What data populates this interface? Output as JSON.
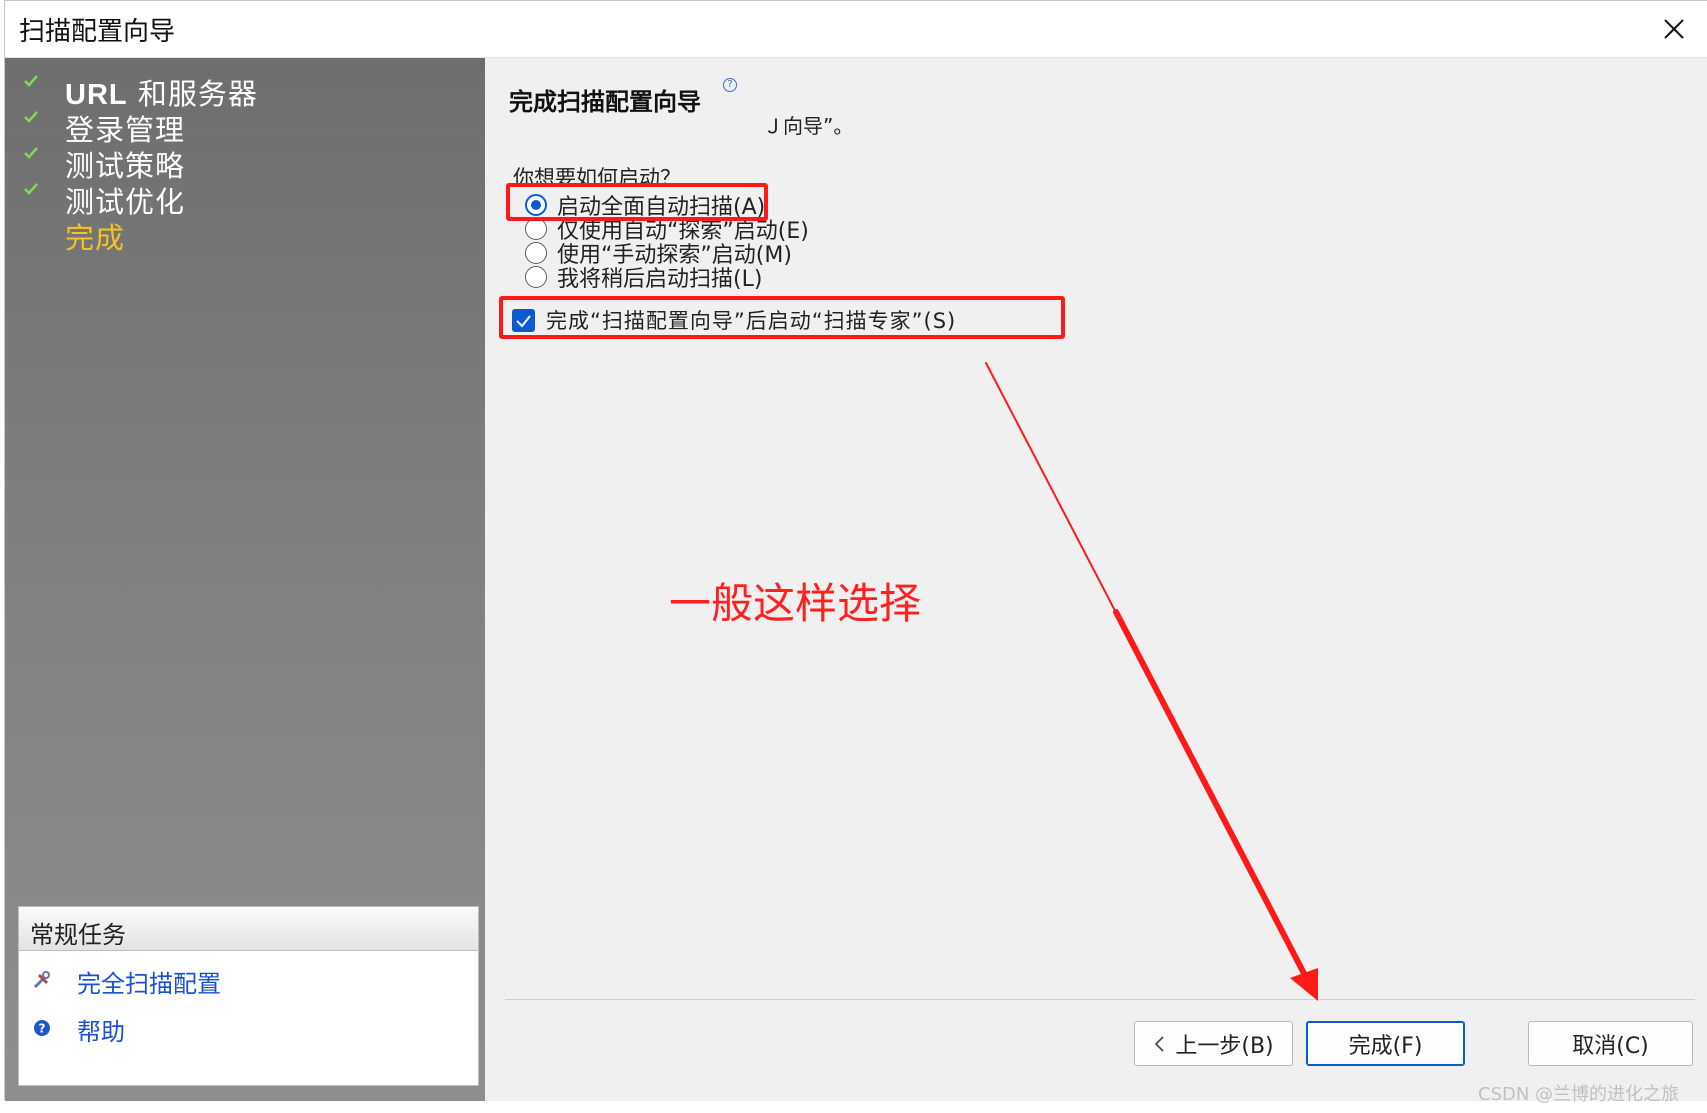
{
  "window": {
    "title": "扫描配置向导"
  },
  "steps": [
    {
      "label": "和服务器",
      "prefix": "URL",
      "done": true
    },
    {
      "label": "登录管理",
      "done": true
    },
    {
      "label": "测试策略",
      "done": true
    },
    {
      "label": "测试优化",
      "done": true
    },
    {
      "label": "完成",
      "done": false,
      "current": true
    }
  ],
  "tasks": {
    "header": "常规任务",
    "items": [
      {
        "label": "完全扫描配置",
        "icon": "tools-icon"
      },
      {
        "label": "帮助",
        "icon": "help-icon"
      }
    ]
  },
  "content": {
    "heading": "完成扫描配置向导",
    "fragment": "Ｊ向导”。",
    "question": "你想要如何启动？",
    "options": [
      {
        "label": "启动全面自动扫描(A)",
        "checked": true
      },
      {
        "label": "仅使用自动“探索”启动(E)",
        "checked": false
      },
      {
        "label": "使用“手动探索”启动(M)",
        "checked": false
      },
      {
        "label": "我将稍后启动扫描(L)",
        "checked": false
      }
    ],
    "checkbox_label": "完成“扫描配置向导”后启动“扫描专家”(S)",
    "annotation": "一般这样选择"
  },
  "buttons": {
    "back": "上一步(B)",
    "finish": "完成(F)",
    "cancel": "取消(C)"
  },
  "watermark": "CSDN @兰博的进化之旅",
  "colors": {
    "accent": "#0a5bd0",
    "current_step": "#f3c223",
    "highlight": "#ff1a1a"
  }
}
